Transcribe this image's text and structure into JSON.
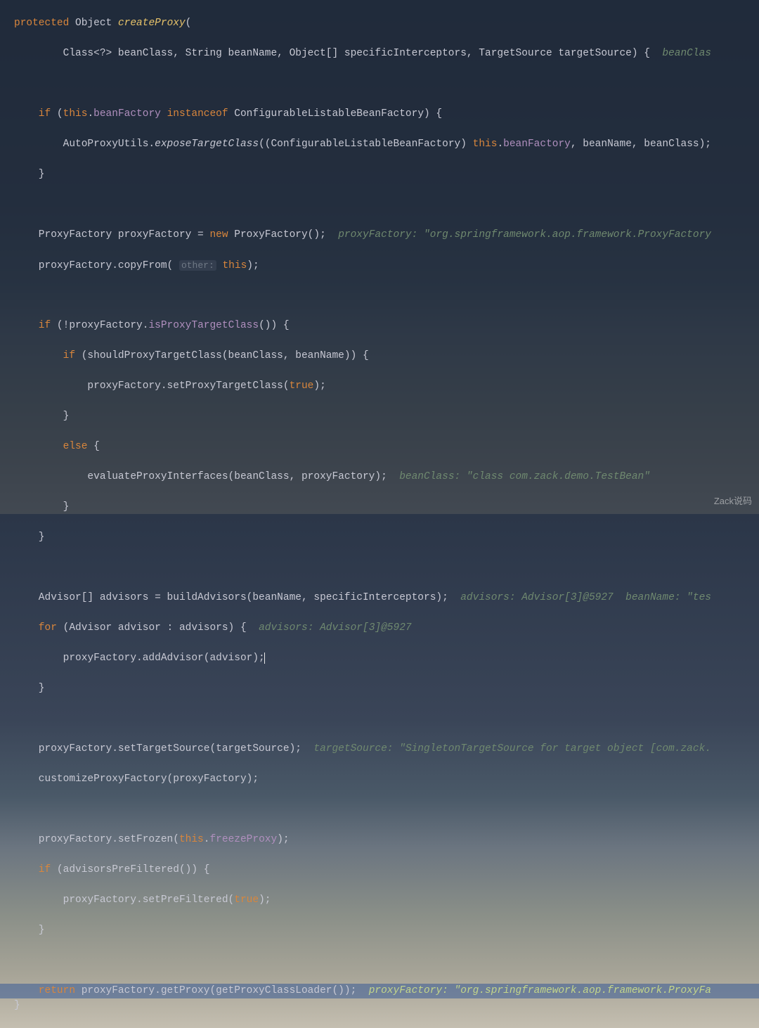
{
  "code": {
    "l1_kw_protected": "protected",
    "l1_type_object": " Object ",
    "l1_method": "createProxy",
    "l1_rest": "(",
    "l2_params": "        Class<?> beanClass, String beanName, Object[] specificInterceptors, TargetSource targetSource) {  ",
    "l2_hint": "beanClas",
    "l4_if": "    if",
    "l4_open": " (",
    "l4_this": "this",
    "l4_dot": ".",
    "l4_field": "beanFactory",
    "l4_space": " ",
    "l4_instanceof": "instanceof",
    "l4_rest": " ConfigurableListableBeanFactory) {",
    "l5_text": "        AutoProxyUtils.",
    "l5_method": "exposeTargetClass",
    "l5_mid": "((ConfigurableListableBeanFactory) ",
    "l5_this": "this",
    "l5_dot": ".",
    "l5_field": "beanFactory",
    "l5_rest": ", beanName, beanClass);",
    "l6": "    }",
    "l8_a": "    ProxyFactory proxyFactory = ",
    "l8_new": "new",
    "l8_b": " ProxyFactory();  ",
    "l8_hint": "proxyFactory: \"org.springframework.aop.framework.ProxyFactory",
    "l9_a": "    proxyFactory.copyFrom( ",
    "l9_param": "other:",
    "l9_sp": " ",
    "l9_this": "this",
    "l9_rest": ");",
    "l11_if": "    if",
    "l11_a": " (!proxyFactory.",
    "l11_field": "isProxyTargetClass",
    "l11_b": "()) {",
    "l12_if": "        if",
    "l12_rest": " (shouldProxyTargetClass(beanClass, beanName)) {",
    "l13_a": "            proxyFactory.setProxyTargetClass(",
    "l13_true": "true",
    "l13_b": ");",
    "l14": "        }",
    "l15_else": "        else",
    "l15_rest": " {",
    "l16_a": "            evaluateProxyInterfaces(beanClass, proxyFactory);  ",
    "l16_hint": "beanClass: \"class com.zack.demo.TestBean\"",
    "l17": "        }",
    "l18": "    }",
    "l20_a": "    Advisor[] advisors = buildAdvisors(beanName, specificInterceptors);  ",
    "l20_hint": "advisors: Advisor[3]@5927  beanName: \"tes",
    "l21_for": "    for",
    "l21_a": " (Advisor advisor : advisors) {  ",
    "l21_hint": "advisors: Advisor[3]@5927",
    "l22": "        proxyFactory.addAdvisor(advisor);",
    "l23": "    }",
    "l25_a": "    proxyFactory.setTargetSource(targetSource);  ",
    "l25_hint": "targetSource: \"SingletonTargetSource for target object [com.zack.",
    "l26": "    customizeProxyFactory(proxyFactory);",
    "l28_a": "    proxyFactory.setFrozen(",
    "l28_this": "this",
    "l28_dot": ".",
    "l28_field": "freezeProxy",
    "l28_b": ");",
    "l29_if": "    if",
    "l29_rest": " (advisorsPreFiltered()) {",
    "l30_a": "        proxyFactory.setPreFiltered(",
    "l30_true": "true",
    "l30_b": ");",
    "l31": "    }",
    "l33_return": "    return",
    "l33_a": " proxyFactory.getProxy(getProxyClassLoader());  ",
    "l33_hint": "proxyFactory: \"org.springframework.aop.framework.ProxyFa",
    "l34": "}"
  },
  "watermark": "Zack说码"
}
